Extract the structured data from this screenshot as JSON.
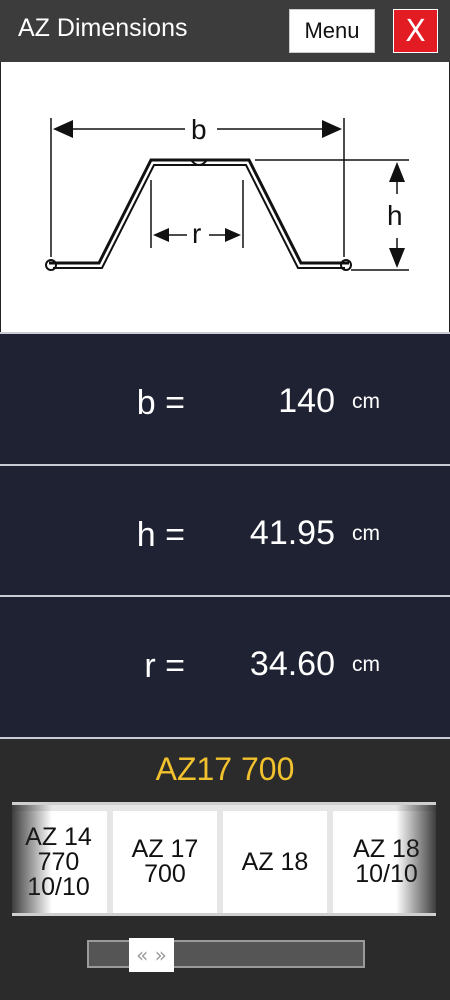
{
  "header": {
    "title": "AZ Dimensions",
    "menu_label": "Menu",
    "close_label": "X"
  },
  "diagram": {
    "label_b": "b",
    "label_h": "h",
    "label_r": "r"
  },
  "dimensions": [
    {
      "label": "b =",
      "value": "140",
      "unit": "cm"
    },
    {
      "label": "h =",
      "value": "41.95",
      "unit": "cm"
    },
    {
      "label": "r =",
      "value": "34.60",
      "unit": "cm"
    }
  ],
  "selected_profile": "AZ17 700",
  "profiles": [
    {
      "label": "AZ 14\n770\n10/10"
    },
    {
      "label": "AZ 17\n700"
    },
    {
      "label": "AZ 18"
    },
    {
      "label": "AZ 18\n10/10"
    }
  ],
  "scrollbar": {
    "thumb_label": "« »"
  },
  "colors": {
    "header_bg": "#3c3c3c",
    "close_bg": "#e31c23",
    "panel_bg": "#1e2232",
    "selected_text": "#f2c12e"
  }
}
